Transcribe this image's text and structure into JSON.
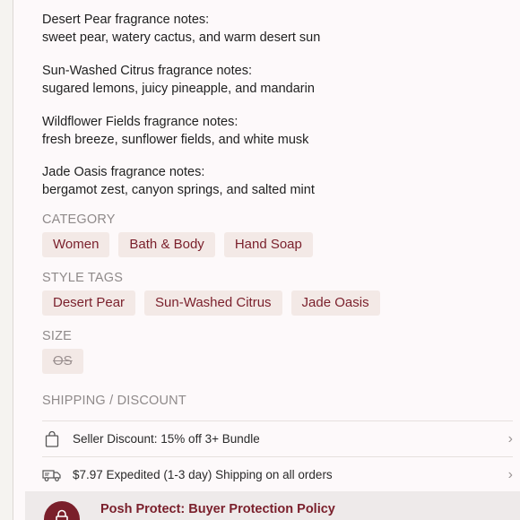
{
  "fragrance_notes": [
    {
      "title": "Desert Pear fragrance notes:",
      "notes": "sweet pear, watery cactus, and warm desert sun"
    },
    {
      "title": "Sun-Washed Citrus fragrance notes:",
      "notes": "sugared lemons, juicy pineapple, and mandarin"
    },
    {
      "title": "Wildflower Fields fragrance notes:",
      "notes": "fresh breeze, sunflower fields, and white musk"
    },
    {
      "title": "Jade Oasis fragrance notes:",
      "notes": "bergamot zest, canyon springs, and salted mint"
    }
  ],
  "category": {
    "label": "CATEGORY",
    "chips": [
      "Women",
      "Bath & Body",
      "Hand Soap"
    ]
  },
  "style_tags": {
    "label": "STYLE TAGS",
    "chips": [
      "Desert Pear",
      "Sun-Washed Citrus",
      "Jade Oasis"
    ]
  },
  "size": {
    "label": "SIZE",
    "value": "OS"
  },
  "shipping": {
    "label": "SHIPPING / DISCOUNT",
    "rows": [
      {
        "icon": "shopping-bag-icon",
        "text": "Seller Discount: 15% off 3+ Bundle"
      },
      {
        "icon": "truck-icon",
        "text": "$7.97 Expedited (1-3 day) Shipping on all orders"
      }
    ]
  },
  "posh_protect": {
    "icon": "lock-icon",
    "title": "Posh Protect: Buyer Protection Policy"
  },
  "colors": {
    "accent": "#7a1f2b",
    "chip_bg": "#f3e9e6",
    "label_gray": "#8f8a8a"
  }
}
